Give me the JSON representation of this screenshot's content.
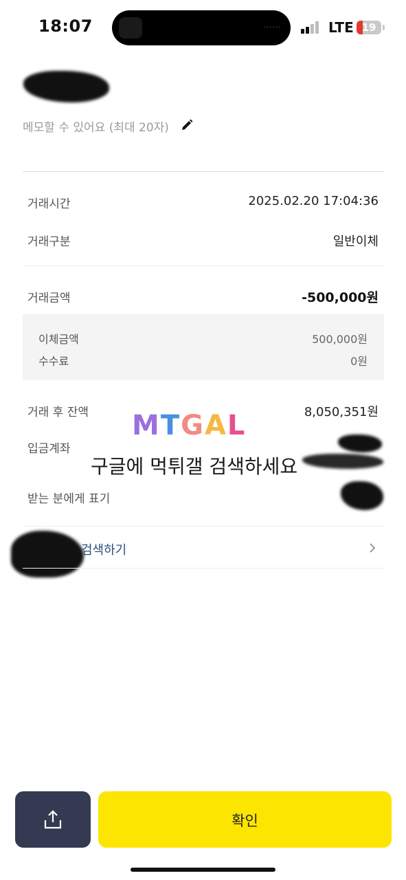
{
  "status_bar": {
    "time": "18:07",
    "network": "LTE",
    "battery": "19"
  },
  "memo": {
    "placeholder": "메모할 수 있어요 (최대 20자)",
    "icon": "pencil-icon"
  },
  "details": {
    "time_label": "거래시간",
    "time_value": "2025.02.20 17:04:36",
    "type_label": "거래구분",
    "type_value": "일반이체",
    "amount_label": "거래금액",
    "amount_value": "-500,000원",
    "transfer_amount_label": "이체금액",
    "transfer_amount_value": "500,000원",
    "fee_label": "수수료",
    "fee_value": "0원",
    "balance_label": "거래 후 잔액",
    "balance_value": "8,050,351원",
    "deposit_account_label": "입금계좌",
    "recipient_display_label": "받는 분에게 표기"
  },
  "search_link": {
    "label": "검색하기"
  },
  "watermark": {
    "logo": "MTGAL",
    "text": "구글에 먹튀갤 검색하세요"
  },
  "buttons": {
    "share_icon": "share-icon",
    "confirm_label": "확인"
  },
  "colors": {
    "confirm": "#fce500",
    "share": "#333a52",
    "battery_low": "#e03b2e",
    "link": "#2a4f7a"
  }
}
